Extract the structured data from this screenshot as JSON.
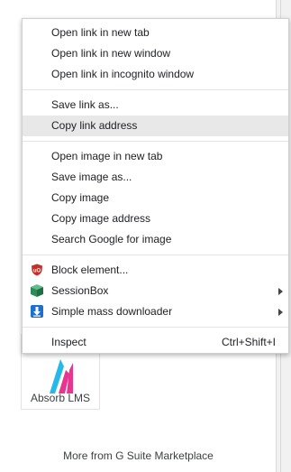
{
  "menu": {
    "group1": [
      "Open link in new tab",
      "Open link in new window",
      "Open link in incognito window"
    ],
    "group2": [
      "Save link as...",
      "Copy link address"
    ],
    "group3": [
      "Open image in new tab",
      "Save image as...",
      "Copy image",
      "Copy image address",
      "Search Google for image"
    ],
    "extensions": {
      "block_element": "Block element...",
      "sessionbox": "SessionBox",
      "mass_downloader": "Simple mass downloader"
    },
    "inspect": {
      "label": "Inspect",
      "shortcut": "Ctrl+Shift+I"
    }
  },
  "page": {
    "app_card_name": "Absorb LMS",
    "more_link": "More from G Suite Marketplace"
  },
  "colors": {
    "ublock_red": "#c4302b",
    "sessionbox_green": "#2e8b57",
    "downloader_blue": "#1f6fd1",
    "absorb_pink": "#e8358f",
    "absorb_cyan": "#27b9e8"
  }
}
